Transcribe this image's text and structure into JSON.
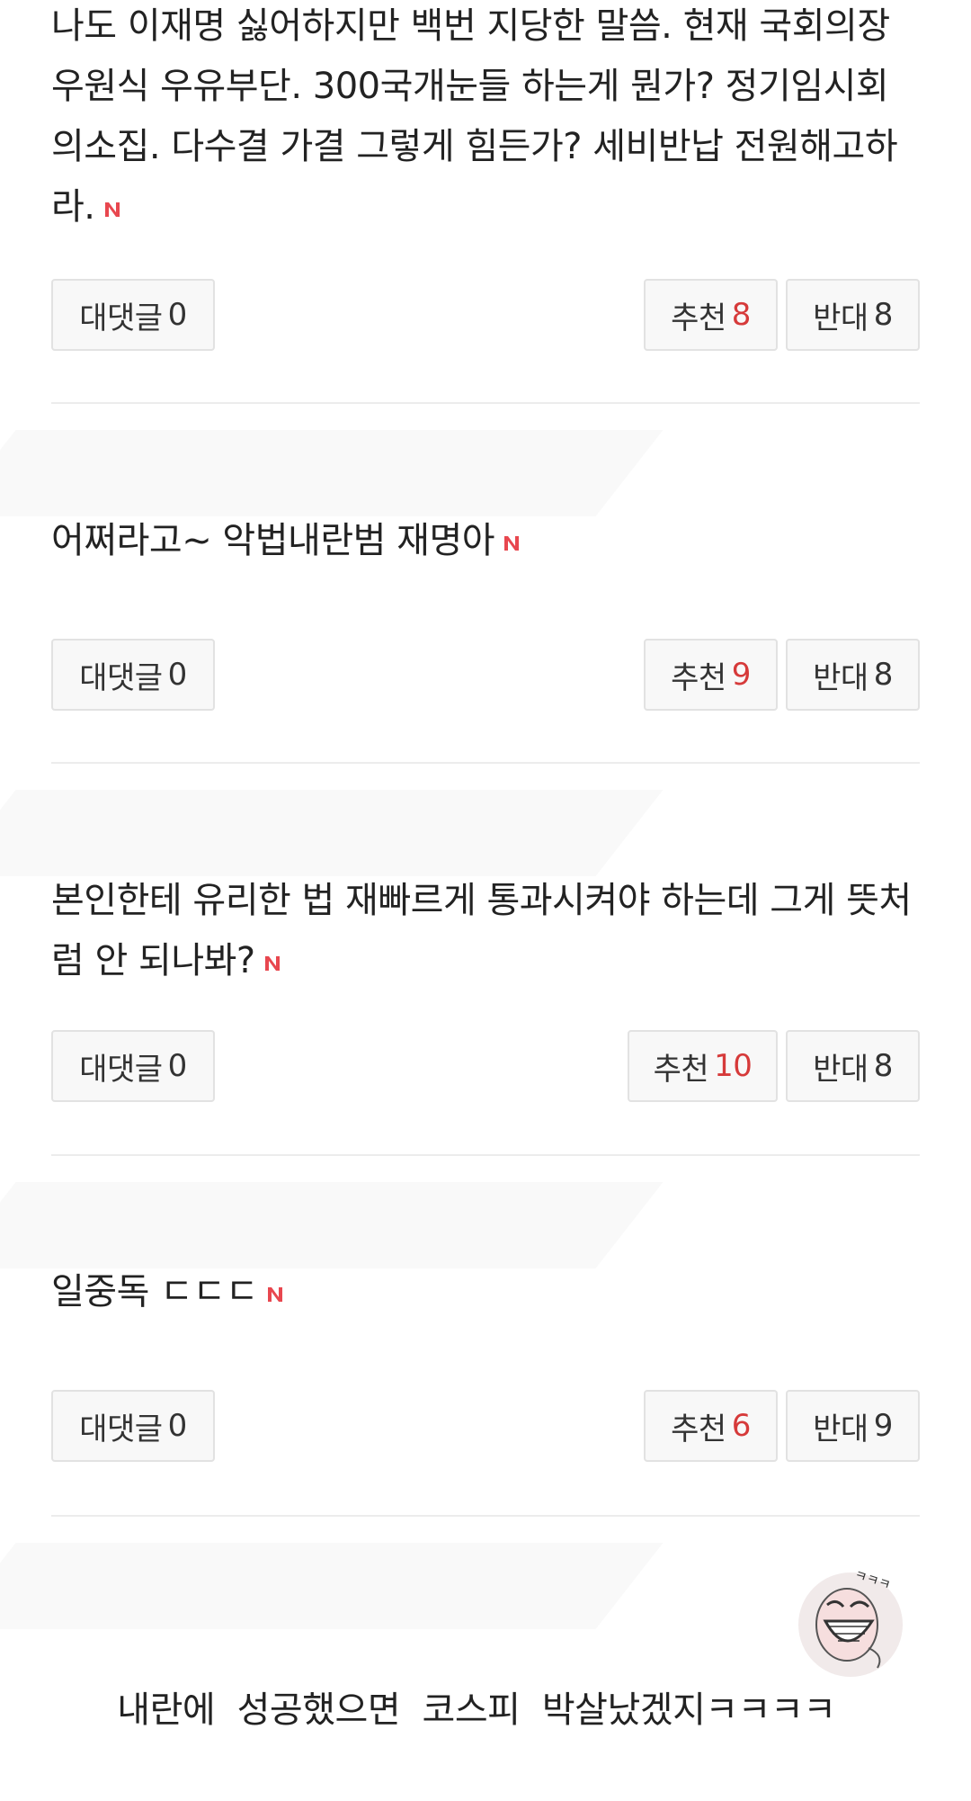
{
  "comments": [
    {
      "text": "나도 이재명 싫어하지만 백번 지당한 말씀. 현재 국회의장 우원식 우유부단. 300국개눈들 하는게 뭔가? 정기임시회 의소집. 다수결 가결 그렇게 힘든가? 세비반납 전원해고하라.",
      "is_new": true,
      "reply_label": "대댓글",
      "reply_count": "0",
      "like_label": "추천",
      "like_count": "8",
      "dislike_label": "반대",
      "dislike_count": "8"
    },
    {
      "text": "어쩌라고~ 악법내란범 재명아",
      "is_new": true,
      "reply_label": "대댓글",
      "reply_count": "0",
      "like_label": "추천",
      "like_count": "9",
      "dislike_label": "반대",
      "dislike_count": "8"
    },
    {
      "text": "본인한테 유리한 법 재빠르게 통과시켜야 하는데 그게 뜻처럼 안 되나봐?",
      "is_new": true,
      "reply_label": "대댓글",
      "reply_count": "0",
      "like_label": "추천",
      "like_count": "10",
      "dislike_label": "반대",
      "dislike_count": "8"
    },
    {
      "text": "일중독 ㄷㄷㄷ",
      "is_new": true,
      "reply_label": "대댓글",
      "reply_count": "0",
      "like_label": "추천",
      "like_count": "6",
      "dislike_label": "반대",
      "dislike_count": "9"
    },
    {
      "text": "내란에  성공했으면  코스피  박살났겠지ㅋㅋㅋㅋ",
      "is_new": false,
      "sticker": "laughing-face-sticker",
      "sticker_text": "ㅋㅋㅋ"
    }
  ],
  "colors": {
    "new_badge": "#e8474f",
    "like_count": "#d63a3a",
    "button_border": "#e2e2e2",
    "button_bg": "#f8f8f8",
    "divider": "#ececec"
  },
  "icons": {
    "new": "new-badge-icon"
  }
}
